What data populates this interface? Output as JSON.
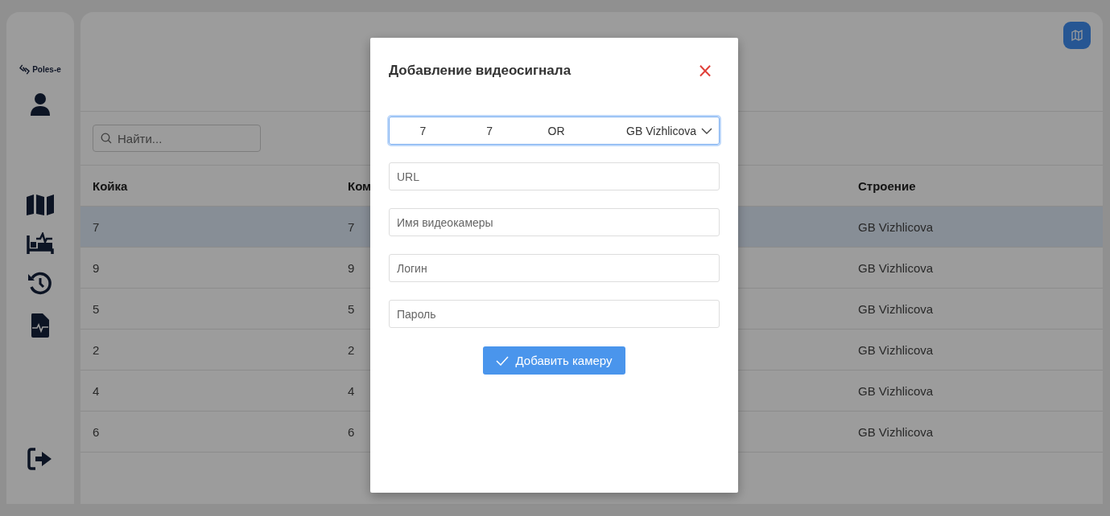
{
  "sidebar": {
    "logo": "Poles-e"
  },
  "search": {
    "placeholder": "Найти..."
  },
  "table": {
    "columns": [
      "Койка",
      "Ком",
      "Строение"
    ],
    "rows": [
      {
        "cells": [
          "7",
          "7",
          "GB Vizhlicova"
        ],
        "selected": true
      },
      {
        "cells": [
          "9",
          "9",
          "GB Vizhlicova"
        ],
        "selected": false
      },
      {
        "cells": [
          "5",
          "5",
          "GB Vizhlicova"
        ],
        "selected": false
      },
      {
        "cells": [
          "2",
          "2",
          "GB Vizhlicova"
        ],
        "selected": false
      },
      {
        "cells": [
          "4",
          "4",
          "GB Vizhlicova"
        ],
        "selected": false
      },
      {
        "cells": [
          "6",
          "6",
          "GB Vizhlicova"
        ],
        "selected": false
      }
    ]
  },
  "dialog": {
    "title": "Добавление видеосигнала",
    "close": "×",
    "select": {
      "values": [
        "7",
        "7",
        "OR",
        "GB Vizhlicova"
      ],
      "focused": true
    },
    "fields": [
      {
        "placeholder": "URL"
      },
      {
        "placeholder": "Имя видеокамеры"
      },
      {
        "placeholder": "Логин"
      },
      {
        "placeholder": "Пароль"
      }
    ],
    "submit": "Добавить камеру"
  }
}
